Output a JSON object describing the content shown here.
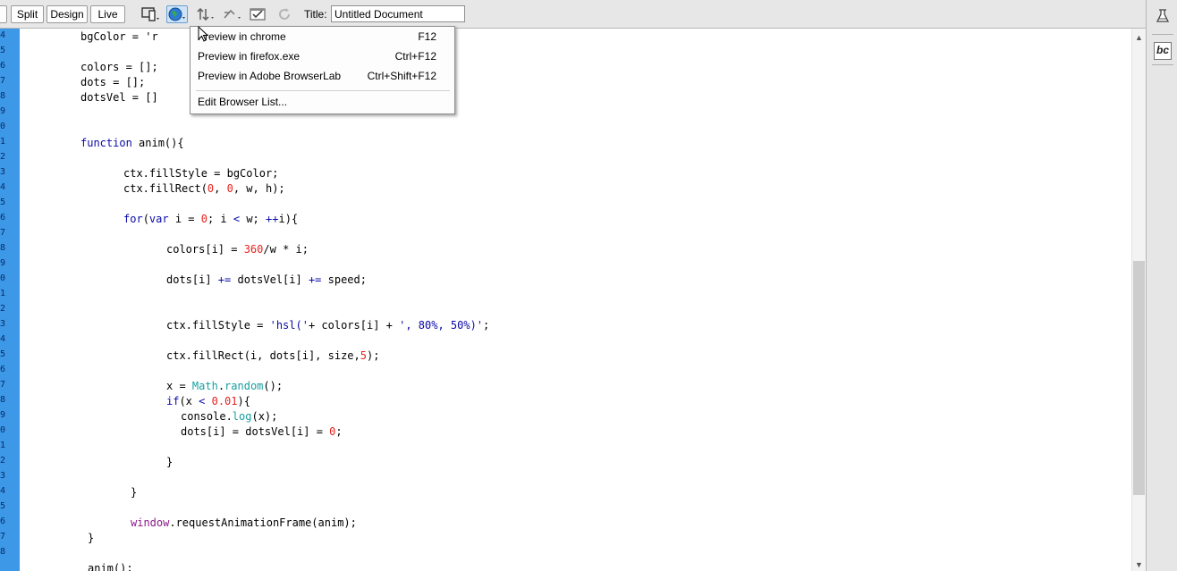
{
  "toolbar": {
    "view_buttons": [
      "Split",
      "Design",
      "Live"
    ],
    "title_label": "Title:",
    "title_value": "Untitled Document",
    "icons": [
      "multiscreen-icon",
      "preview-browser-icon",
      "file-management-icon",
      "check-browser-icon",
      "validate-icon",
      "refresh-icon"
    ]
  },
  "browser_menu": {
    "items": [
      {
        "label": "Preview in chrome",
        "shortcut": "F12"
      },
      {
        "label": "Preview in firefox.exe",
        "shortcut": "Ctrl+F12"
      },
      {
        "label": "Preview in Adobe BrowserLab",
        "shortcut": "Ctrl+Shift+F12"
      },
      {
        "label": "Edit Browser List...",
        "shortcut": ""
      }
    ]
  },
  "editor": {
    "line_numbers": [
      "4",
      "5",
      "6",
      "7",
      "8",
      "9",
      "0",
      "1",
      "2",
      "3",
      "4",
      "5",
      "6",
      "7",
      "8",
      "9",
      "0",
      "1",
      "2",
      "3",
      "4",
      "5",
      "6",
      "7",
      "8",
      "9",
      "0",
      "1",
      "2",
      "3",
      "4",
      "5",
      "6",
      "7",
      "8"
    ],
    "code_lines": [
      "bgColor = 'r",
      "",
      "colors = [];",
      "dots = [];",
      "dotsVel = []",
      "",
      "",
      "function anim(){",
      "",
      "ctx.fillStyle = bgColor;",
      "ctx.fillRect(0, 0, w, h);",
      "",
      "for(var i = 0; i < w; ++i){",
      "",
      "colors[i] = 360/w * i;",
      "",
      "dots[i] += dotsVel[i] += speed;",
      "",
      "",
      "ctx.fillStyle = 'hsl('+ colors[i] + ', 80%, 50%)';",
      "",
      "ctx.fillRect(i, dots[i], size,5);",
      "",
      "x = Math.random();",
      "if(x < 0.01){",
      "console.log(x);",
      "dots[i] = dotsVel[i] = 0;",
      "",
      "}",
      "",
      "}",
      "",
      "window.requestAnimationFrame(anim);",
      "}",
      "",
      "anim();"
    ]
  },
  "right_panel": {
    "icons": [
      "insert-panel-icon",
      "business-catalyst-icon"
    ],
    "bc_label": "bc"
  },
  "colors": {
    "gutter": "#3d98e8",
    "keyword": "#0a0aa8",
    "number": "#e4231f",
    "method": "#18a0a0"
  }
}
